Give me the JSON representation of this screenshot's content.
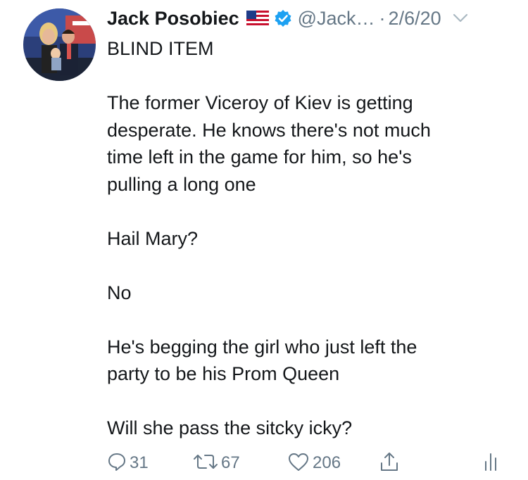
{
  "tweet": {
    "author_name": "Jack Posobiec",
    "flag_icon": "us-flag-icon",
    "verified": true,
    "handle": "@Jack…",
    "separator": "·",
    "date": "2/6/20",
    "text_lines": [
      "BLIND ITEM",
      "",
      "The former Viceroy of Kiev is getting",
      "desperate. He knows there's not much",
      "time left in the game for him, so he's",
      "pulling a long one",
      "",
      "Hail Mary?",
      "",
      "No",
      "",
      "He's begging the girl who just left the",
      "party to be his Prom Queen",
      "",
      "Will she pass the sitcky icky?"
    ]
  },
  "actions": {
    "reply_count": "31",
    "retweet_count": "67",
    "like_count": "206"
  },
  "colors": {
    "text": "#14171a",
    "secondary": "#657786",
    "verified_blue": "#1da1f2"
  }
}
